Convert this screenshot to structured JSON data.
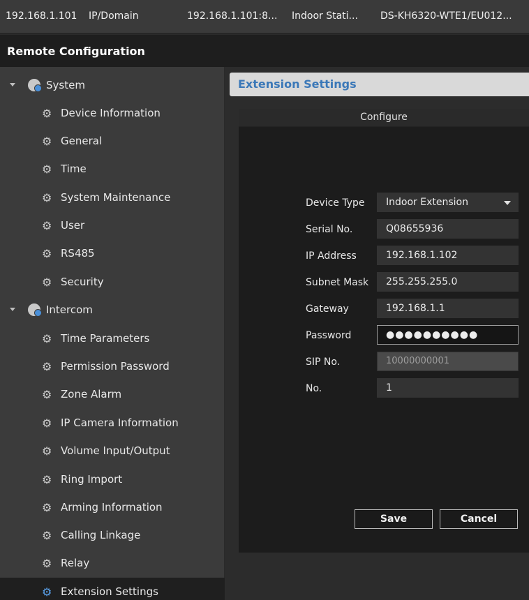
{
  "device_row": {
    "ip": "192.168.1.101",
    "addr_type": "IP/Domain",
    "port_addr": "192.168.1.101:8...",
    "device_kind": "Indoor Stati...",
    "model": "DS-KH6320-WTE1/EU012..."
  },
  "window": {
    "title": "Remote Configuration"
  },
  "sidebar": {
    "system": {
      "label": "System",
      "items": [
        "Device Information",
        "General",
        "Time",
        "System Maintenance",
        "User",
        "RS485",
        "Security"
      ]
    },
    "intercom": {
      "label": "Intercom",
      "items": [
        "Time Parameters",
        "Permission Password",
        "Zone Alarm",
        "IP Camera Information",
        "Volume Input/Output",
        "Ring Import",
        "Arming Information",
        "Calling Linkage",
        "Relay",
        "Extension Settings"
      ]
    },
    "selected": "Extension Settings"
  },
  "content": {
    "header": "Extension Settings"
  },
  "dialog": {
    "title": "Configure",
    "fields": {
      "device_type": {
        "label": "Device Type",
        "value": "Indoor Extension"
      },
      "serial_no": {
        "label": "Serial No.",
        "value": "Q08655936"
      },
      "ip_address": {
        "label": "IP Address",
        "value": "192.168.1.102"
      },
      "subnet_mask": {
        "label": "Subnet Mask",
        "value": "255.255.255.0"
      },
      "gateway": {
        "label": "Gateway",
        "value": "192.168.1.1"
      },
      "password": {
        "label": "Password",
        "value": "●●●●●●●●●●"
      },
      "sip_no": {
        "label": "SIP No.",
        "value": "10000000001"
      },
      "no": {
        "label": "No.",
        "value": "1"
      }
    },
    "save_label": "Save",
    "cancel_label": "Cancel"
  },
  "colors": {
    "accent": "#3b78b8",
    "selected_bg": "#1f1f1f",
    "dialog_bg": "#1c1c1c"
  },
  "icons": {
    "group": "settings-cog-icon",
    "item": "gear-icon",
    "expand": "caret-down-icon"
  }
}
